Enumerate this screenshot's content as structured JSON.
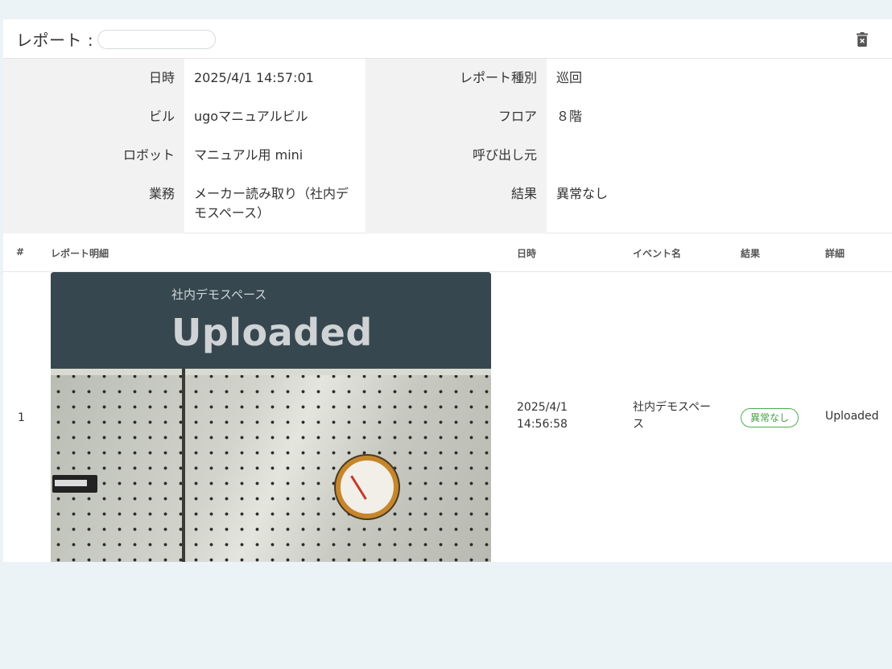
{
  "header": {
    "title": "レポート :",
    "name_value": "",
    "delete_icon": "delete-icon"
  },
  "info": {
    "datetime": {
      "label": "日時",
      "value": "2025/4/1 14:57:01"
    },
    "report_type": {
      "label": "レポート種別",
      "value": "巡回"
    },
    "building": {
      "label": "ビル",
      "value": "ugoマニュアルビル"
    },
    "floor": {
      "label": "フロア",
      "value": "８階"
    },
    "robot": {
      "label": "ロボット",
      "value": "マニュアル用 mini"
    },
    "caller": {
      "label": "呼び出し元",
      "value": ""
    },
    "task": {
      "label": "業務",
      "value_line1": "メーカー読み取り（社内デ",
      "value_line2": "モスペース）"
    },
    "result": {
      "label": "結果",
      "value": "異常なし"
    }
  },
  "table": {
    "columns": {
      "index": "#",
      "detail": "レポート明細",
      "datetime": "日時",
      "event": "イベント名",
      "result": "結果",
      "info": "詳細"
    },
    "rows": [
      {
        "index": "1",
        "thumb_subtitle": "社内デモスペース",
        "thumb_title": "Uploaded",
        "date": "2025/4/1",
        "time": "14:56:58",
        "event_line1": "社内デモスペー",
        "event_line2": "ス",
        "result": "異常なし",
        "detail": "Uploaded"
      }
    ]
  },
  "colors": {
    "background": "#ecf3f7",
    "thumb_header": "#37474f",
    "ok_badge": "#4caf50"
  }
}
